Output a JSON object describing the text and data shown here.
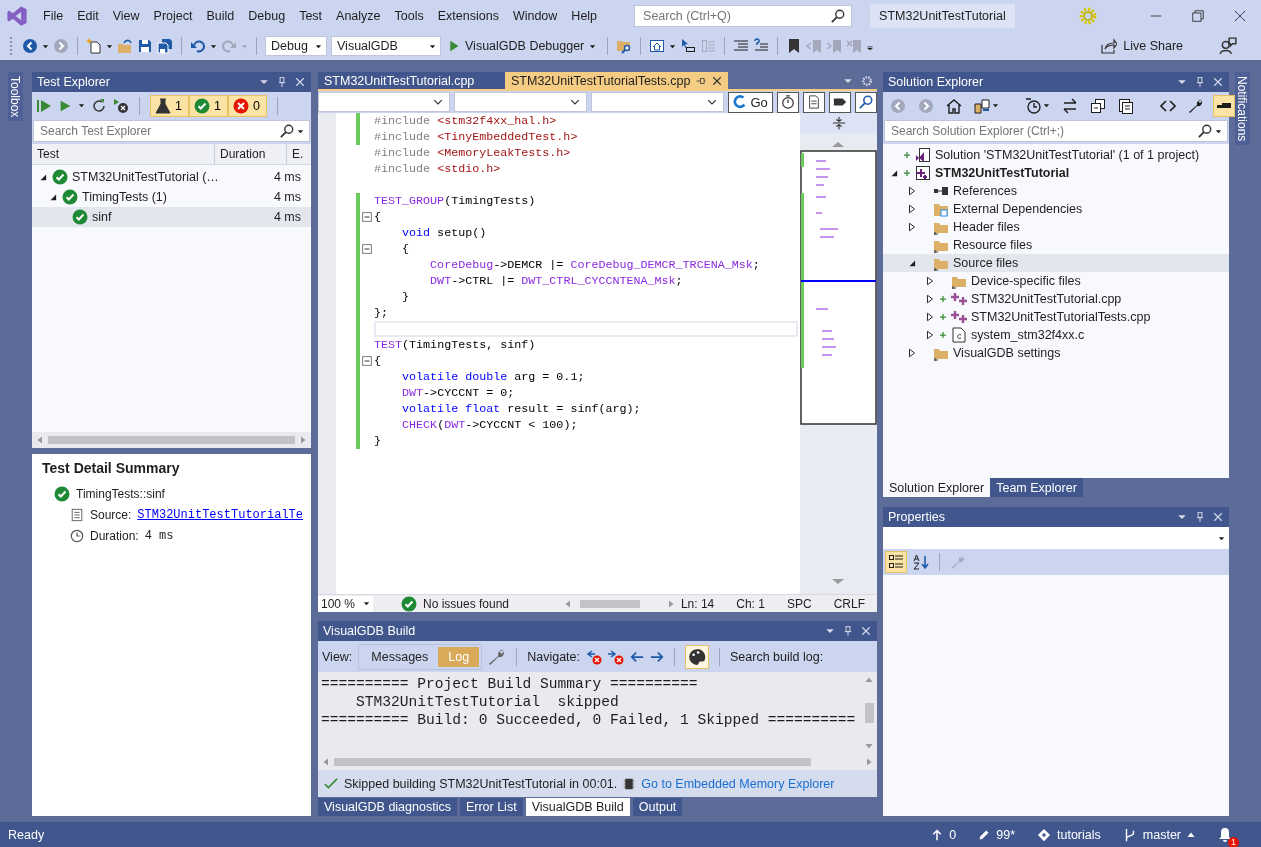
{
  "menu": [
    "File",
    "Edit",
    "View",
    "Project",
    "Build",
    "Debug",
    "Test",
    "Analyze",
    "Tools",
    "Extensions",
    "Window",
    "Help"
  ],
  "search": {
    "placeholder": "Search (Ctrl+Q)"
  },
  "window": {
    "title": "STM32UnitTestTutorial"
  },
  "toolbar": {
    "items": [
      {
        "kind": "back",
        "disabled": false
      },
      {
        "kind": "forward",
        "disabled": true
      },
      {
        "kind": "separator"
      },
      {
        "kind": "new",
        "disabled": false
      },
      {
        "kind": "open",
        "disabled": false
      },
      {
        "kind": "save",
        "disabled": false
      },
      {
        "kind": "save_all",
        "disabled": false
      },
      {
        "kind": "separator"
      },
      {
        "kind": "undo",
        "disabled": false
      },
      {
        "kind": "redo",
        "disabled": true
      },
      {
        "kind": "separator"
      },
      {
        "kind": "combo",
        "text": "Debug"
      },
      {
        "kind": "combo",
        "text": "VisualGDB"
      },
      {
        "kind": "start",
        "text": "VisualGDB Debugger"
      },
      {
        "kind": "separator"
      },
      {
        "kind": "find",
        "disabled": false
      },
      {
        "kind": "separator"
      },
      {
        "kind": "window",
        "disabled": false
      },
      {
        "kind": "cursor",
        "disabled": false
      },
      {
        "kind": "list",
        "disabled": true
      },
      {
        "kind": "separator"
      },
      {
        "kind": "indent",
        "disabled": false
      },
      {
        "kind": "help_lines",
        "disabled": false
      },
      {
        "kind": "separator"
      },
      {
        "kind": "bookmark",
        "disabled": false
      },
      {
        "kind": "bookmark_prev",
        "disabled": true
      },
      {
        "kind": "bookmark_next",
        "disabled": true
      },
      {
        "kind": "bookmark_clear",
        "disabled": true
      },
      {
        "kind": "overflow"
      }
    ],
    "live_share": "Live Share"
  },
  "side_tabs": {
    "left": "Toolbox",
    "right": "Notifications"
  },
  "test_explorer": {
    "title": "Test Explorer",
    "counters": [
      {
        "kind": "total",
        "count": "1"
      },
      {
        "kind": "passed",
        "count": "1"
      },
      {
        "kind": "failed",
        "count": "0"
      }
    ],
    "search": {
      "placeholder": "Search Test Explorer"
    },
    "columns": [
      "Test",
      "Duration",
      "E."
    ],
    "tests": [
      {
        "name": "STM32UnitTestTutorial (…",
        "duration": "4 ms",
        "passed": true,
        "expanded": true,
        "selected": false,
        "children": [
          {
            "name": "TimingTests (1)",
            "duration": "4 ms",
            "passed": true,
            "expanded": true,
            "selected": false,
            "children": [
              {
                "name": "sinf",
                "duration": "4 ms",
                "passed": true,
                "selected": true
              }
            ]
          }
        ]
      }
    ]
  },
  "test_detail": {
    "title": "Test Detail Summary",
    "test": "TimingTests::sinf",
    "passed": true,
    "source_label": "Source:",
    "source": "STM32UnitTestTutorialTe",
    "duration_label": "Duration:",
    "duration": "4 ms"
  },
  "editor": {
    "tabs": [
      {
        "label": "STM32UnitTestTutorial.cpp",
        "selected": false
      },
      {
        "label": "STM32UnitTestTutorialTests.cpp",
        "selected": true
      }
    ],
    "go": "Go",
    "lines": [
      {
        "changed": true,
        "fold": false,
        "current": false,
        "tokens": [
          {
            "kind": "preproc",
            "text": "#include "
          },
          {
            "kind": "string",
            "text": "<stm32f4xx_hal.h>"
          }
        ]
      },
      {
        "changed": true,
        "fold": false,
        "current": false,
        "tokens": [
          {
            "kind": "preproc",
            "text": "#include "
          },
          {
            "kind": "string",
            "text": "<TinyEmbeddedTest.h>"
          }
        ]
      },
      {
        "changed": false,
        "fold": false,
        "current": false,
        "tokens": [
          {
            "kind": "preproc",
            "text": "#include "
          },
          {
            "kind": "string",
            "text": "<MemoryLeakTests.h>"
          }
        ]
      },
      {
        "changed": false,
        "fold": false,
        "current": false,
        "tokens": [
          {
            "kind": "preproc",
            "text": "#include "
          },
          {
            "kind": "string",
            "text": "<stdio.h>"
          }
        ]
      },
      {
        "changed": false,
        "fold": false,
        "current": false
      },
      {
        "changed": true,
        "fold": false,
        "current": false,
        "tokens": [
          {
            "kind": "macro",
            "text": "TEST_GROUP"
          },
          {
            "kind": "plain",
            "text": "(TimingTests)"
          }
        ]
      },
      {
        "changed": true,
        "fold": true,
        "current": false,
        "tokens": [
          {
            "kind": "plain",
            "text": "{"
          }
        ]
      },
      {
        "changed": true,
        "fold": false,
        "current": false,
        "tokens": [
          {
            "kind": "keyword",
            "text": "    void"
          },
          {
            "kind": "plain",
            "text": " setup()"
          }
        ]
      },
      {
        "changed": true,
        "fold": true,
        "current": false,
        "tokens": [
          {
            "kind": "plain",
            "text": "    {"
          }
        ]
      },
      {
        "changed": true,
        "fold": false,
        "current": false,
        "tokens": [
          {
            "kind": "macro",
            "text": "        CoreDebug"
          },
          {
            "kind": "plain",
            "text": "->DEMCR |= "
          },
          {
            "kind": "macro",
            "text": "CoreDebug_DEMCR_TRCENA_Msk"
          },
          {
            "kind": "plain",
            "text": ";"
          }
        ]
      },
      {
        "changed": true,
        "fold": false,
        "current": false,
        "tokens": [
          {
            "kind": "macro",
            "text": "        DWT"
          },
          {
            "kind": "plain",
            "text": "->CTRL |= "
          },
          {
            "kind": "macro",
            "text": "DWT_CTRL_CYCCNTENA_Msk"
          },
          {
            "kind": "plain",
            "text": ";"
          }
        ]
      },
      {
        "changed": true,
        "fold": false,
        "current": false,
        "tokens": [
          {
            "kind": "plain",
            "text": "    }"
          }
        ]
      },
      {
        "changed": true,
        "fold": false,
        "current": false,
        "tokens": [
          {
            "kind": "plain",
            "text": "};"
          }
        ]
      },
      {
        "changed": true,
        "fold": false,
        "current": true
      },
      {
        "changed": true,
        "fold": false,
        "current": false,
        "tokens": [
          {
            "kind": "macro",
            "text": "TEST"
          },
          {
            "kind": "plain",
            "text": "(TimingTests, sinf)"
          }
        ]
      },
      {
        "changed": true,
        "fold": true,
        "current": false,
        "tokens": [
          {
            "kind": "plain",
            "text": "{"
          }
        ]
      },
      {
        "changed": true,
        "fold": false,
        "current": false,
        "tokens": [
          {
            "kind": "keyword",
            "text": "    volatile double"
          },
          {
            "kind": "plain",
            "text": " arg = 0.1;"
          }
        ]
      },
      {
        "changed": true,
        "fold": false,
        "current": false,
        "tokens": [
          {
            "kind": "macro",
            "text": "    DWT"
          },
          {
            "kind": "plain",
            "text": "->CYCCNT = 0;"
          }
        ]
      },
      {
        "changed": true,
        "fold": false,
        "current": false,
        "tokens": [
          {
            "kind": "keyword",
            "text": "    volatile float"
          },
          {
            "kind": "plain",
            "text": " result = sinf(arg);"
          }
        ]
      },
      {
        "changed": true,
        "fold": false,
        "current": false,
        "tokens": [
          {
            "kind": "macro",
            "text": "    CHECK"
          },
          {
            "kind": "plain",
            "text": "("
          },
          {
            "kind": "macro",
            "text": "DWT"
          },
          {
            "kind": "plain",
            "text": "->CYCCNT < 100);"
          }
        ]
      },
      {
        "changed": true,
        "fold": false,
        "current": false,
        "tokens": [
          {
            "kind": "plain",
            "text": "}"
          }
        ]
      }
    ],
    "status": {
      "zoom": "100 %",
      "issues": "No issues found",
      "line": "Ln: 14",
      "column": "Ch: 1",
      "whitespace": "SPC",
      "line_ending": "CRLF"
    }
  },
  "build": {
    "title": "VisualGDB Build",
    "view_label": "View:",
    "views": [
      {
        "label": "Messages",
        "selected": false
      },
      {
        "label": "Log",
        "selected": true
      }
    ],
    "navigate_label": "Navigate:",
    "colorize": true,
    "search_label": "Search build log:",
    "log": [
      "========== Project Build Summary ==========",
      "    STM32UnitTestTutorial  skipped",
      "========== Build: 0 Succeeded, 0 Failed, 1 Skipped =========="
    ],
    "result": "Skipped building STM32UnitTestTutorial in 00:01.",
    "link": "Go to Embedded Memory Explorer"
  },
  "bottom_tabs": [
    {
      "label": "VisualGDB diagnostics",
      "selected": false
    },
    {
      "label": "Error List",
      "selected": false
    },
    {
      "label": "VisualGDB Build",
      "selected": true
    },
    {
      "label": "Output",
      "selected": false
    }
  ],
  "solution_explorer": {
    "title": "Solution Explorer",
    "tools": [
      {
        "kind": "back",
        "disabled": true,
        "on": false
      },
      {
        "kind": "forward",
        "disabled": true,
        "on": false
      },
      {
        "kind": "home",
        "disabled": false,
        "on": false
      },
      {
        "kind": "switch",
        "disabled": false,
        "on": false
      },
      {
        "kind": "separator"
      },
      {
        "kind": "pending",
        "disabled": false,
        "on": false
      },
      {
        "kind": "sync",
        "disabled": false,
        "on": false
      },
      {
        "kind": "collapse",
        "disabled": false,
        "on": false
      },
      {
        "kind": "show_all",
        "disabled": false,
        "on": false
      },
      {
        "kind": "separator"
      },
      {
        "kind": "code",
        "disabled": false,
        "on": false
      },
      {
        "kind": "properties",
        "disabled": false,
        "on": false
      },
      {
        "kind": "preview",
        "disabled": false,
        "on": true
      }
    ],
    "search": {
      "placeholder": "Search Solution Explorer (Ctrl+;)"
    },
    "items": [
      {
        "kind": "solution",
        "name": "Solution 'STM32UnitTestTutorial' (1 of 1 project)",
        "added": true,
        "selected": false
      },
      {
        "kind": "project",
        "name": "STM32UnitTestTutorial",
        "added": true,
        "expanded": true,
        "selected": false,
        "children": [
          {
            "kind": "references",
            "name": "References",
            "added": false,
            "expanded": false,
            "selected": false
          },
          {
            "kind": "external",
            "name": "External Dependencies",
            "added": false,
            "expanded": false,
            "selected": false
          },
          {
            "kind": "folder",
            "name": "Header files",
            "added": false,
            "expanded": false,
            "selected": false
          },
          {
            "kind": "folder",
            "name": "Resource files",
            "added": false,
            "selected": false
          },
          {
            "kind": "folder",
            "name": "Source files",
            "added": false,
            "expanded": true,
            "selected": true,
            "children": [
              {
                "kind": "folder",
                "name": "Device-specific files",
                "added": false,
                "expanded": false,
                "selected": false
              },
              {
                "kind": "cpp",
                "name": "STM32UnitTestTutorial.cpp",
                "added": true,
                "expanded": false,
                "selected": false
              },
              {
                "kind": "cpp",
                "name": "STM32UnitTestTutorialTests.cpp",
                "added": true,
                "expanded": false,
                "selected": false
              },
              {
                "kind": "c",
                "name": "system_stm32f4xx.c",
                "added": true,
                "expanded": false,
                "selected": false
              }
            ]
          },
          {
            "kind": "folder",
            "name": "VisualGDB settings",
            "added": false,
            "expanded": false,
            "selected": false
          }
        ]
      }
    ],
    "tabs": [
      {
        "label": "Solution Explorer",
        "selected": true
      },
      {
        "label": "Team Explorer",
        "selected": false
      }
    ]
  },
  "properties": {
    "title": "Properties",
    "tools": [
      {
        "kind": "categorized",
        "disabled": false,
        "on": true
      },
      {
        "kind": "alphabetical",
        "disabled": false,
        "on": false
      },
      {
        "kind": "separator"
      },
      {
        "kind": "pages",
        "disabled": true,
        "on": false
      }
    ]
  },
  "status_bar": {
    "text": "Ready",
    "items": [
      {
        "kind": "push",
        "text": "0"
      },
      {
        "kind": "changes",
        "text": "99*"
      },
      {
        "kind": "repository",
        "text": "tutorials"
      },
      {
        "kind": "branch",
        "text": "master"
      }
    ],
    "notifications": "1"
  }
}
